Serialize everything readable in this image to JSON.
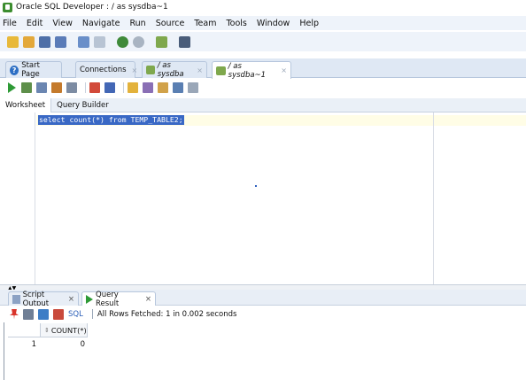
{
  "window": {
    "title": "Oracle SQL Developer : / as sysdba~1"
  },
  "menu": [
    {
      "label": "File"
    },
    {
      "label": "Edit"
    },
    {
      "label": "View"
    },
    {
      "label": "Navigate"
    },
    {
      "label": "Run"
    },
    {
      "label": "Source"
    },
    {
      "label": "Team"
    },
    {
      "label": "Tools"
    },
    {
      "label": "Window"
    },
    {
      "label": "Help"
    }
  ],
  "doc_tabs": [
    {
      "label": "Start Page",
      "icon": "help-icon"
    },
    {
      "label": "Connections",
      "icon": "none"
    },
    {
      "label": "/ as sysdba",
      "icon": "connection-icon"
    },
    {
      "label": "/ as sysdba~1",
      "icon": "connection-icon",
      "active": true
    }
  ],
  "editor_tabs": [
    {
      "label": "Worksheet",
      "active": true
    },
    {
      "label": "Query Builder"
    }
  ],
  "editor": {
    "sql": "select count(*) from TEMP_TABLE2;"
  },
  "result_tabs": [
    {
      "label": "Script Output",
      "icon": "script-output-icon"
    },
    {
      "label": "Query Result",
      "icon": "query-result-icon",
      "active": true
    }
  ],
  "result_toolbar": {
    "sql_label": "SQL",
    "status": "All Rows Fetched: 1 in 0.002 seconds"
  },
  "grid": {
    "columns": [
      "COUNT(*)"
    ],
    "rows": [
      {
        "row_num": "1",
        "values": [
          "0"
        ]
      }
    ]
  },
  "colors": {
    "selection": "#3968c5",
    "run_green": "#2e9a36",
    "accent_blue": "#2d6fc4"
  }
}
